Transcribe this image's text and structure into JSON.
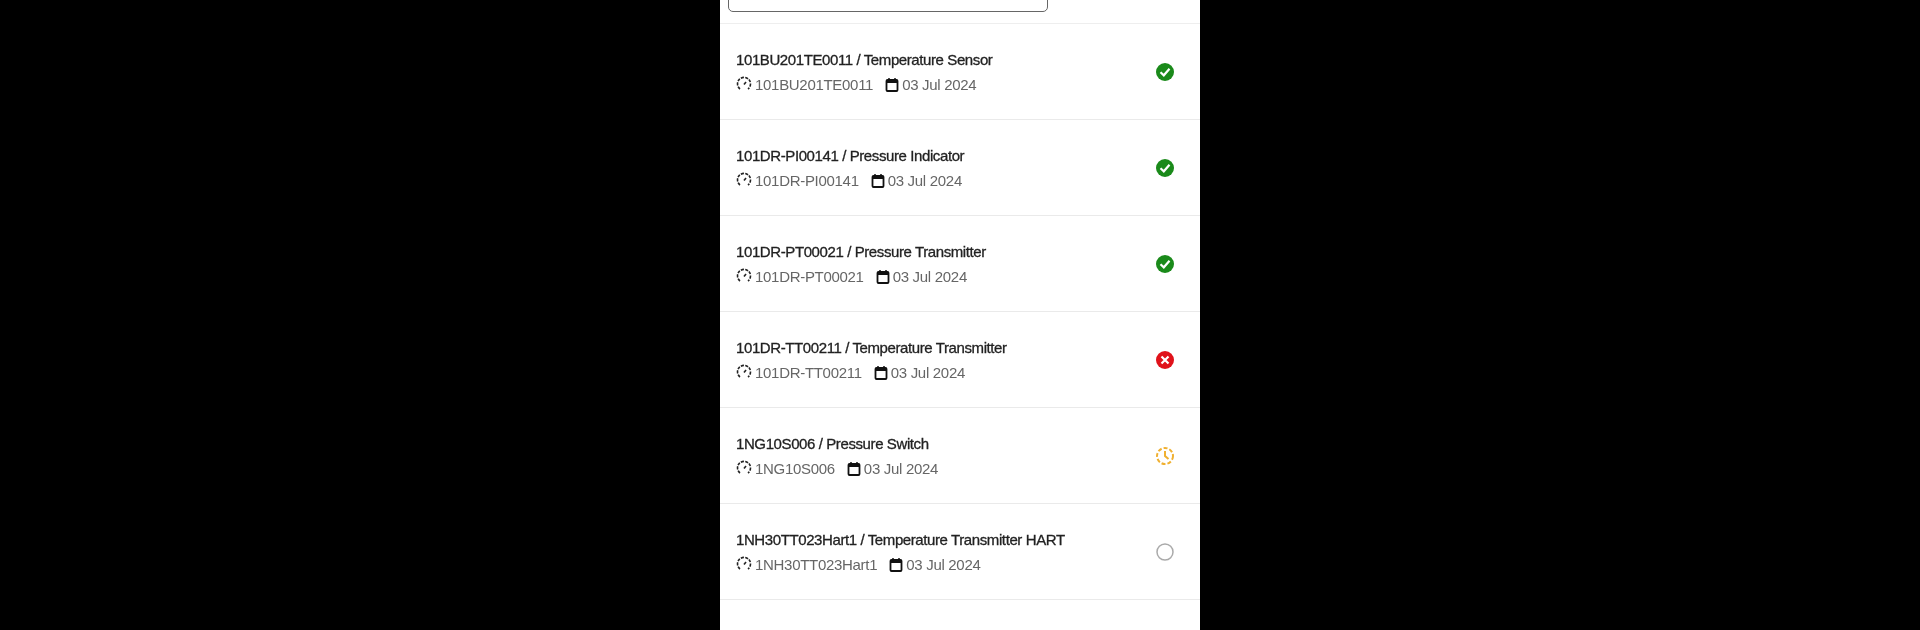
{
  "items": [
    {
      "title": "101BU201TE0011 / Temperature Sensor",
      "tag": "101BU201TE0011",
      "date": "03 Jul 2024",
      "kind": "done"
    },
    {
      "title": "101DR-PI00141 / Pressure Indicator",
      "tag": "101DR-PI00141",
      "date": "03 Jul 2024",
      "kind": "done"
    },
    {
      "title": "101DR-PT00021 / Pressure Transmitter",
      "tag": "101DR-PT00021",
      "date": "03 Jul 2024",
      "kind": "done"
    },
    {
      "title": "101DR-TT00211 / Temperature Transmitter",
      "tag": "101DR-TT00211",
      "date": "03 Jul 2024",
      "kind": "failed"
    },
    {
      "title": "1NG10S006 / Pressure Switch",
      "tag": "1NG10S006",
      "date": "03 Jul 2024",
      "kind": "pending"
    },
    {
      "title": "1NH30TT023Hart1 / Temperature Transmitter HART",
      "tag": "1NH30TT023Hart1",
      "date": "03 Jul 2024",
      "kind": "open"
    }
  ]
}
